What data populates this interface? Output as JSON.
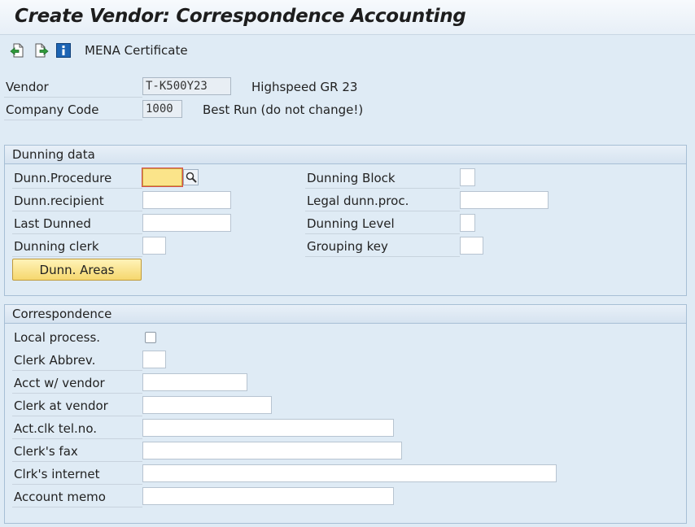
{
  "window": {
    "title": "Create Vendor: Correspondence Accounting"
  },
  "toolbar": {
    "icons": [
      "prev-screen-icon",
      "next-screen-icon",
      "info-icon"
    ],
    "mena_label": "MENA Certificate"
  },
  "header": {
    "vendor_label": "Vendor",
    "vendor_value": "T-K500Y23",
    "vendor_name": "Highspeed GR 23",
    "company_label": "Company Code",
    "company_value": "1000",
    "company_name": "Best Run (do not change!)"
  },
  "dunning": {
    "title": "Dunning data",
    "procedure_label": "Dunn.Procedure",
    "procedure_value": "",
    "recipient_label": "Dunn.recipient",
    "recipient_value": "",
    "last_dunned_label": "Last Dunned",
    "last_dunned_value": "",
    "clerk_label": "Dunning clerk",
    "clerk_value": "",
    "block_label": "Dunning Block",
    "block_value": "",
    "legal_label": "Legal dunn.proc.",
    "legal_value": "",
    "level_label": "Dunning Level",
    "level_value": "",
    "grouping_label": "Grouping key",
    "grouping_value": "",
    "areas_button": "Dunn. Areas"
  },
  "correspondence": {
    "title": "Correspondence",
    "local_process_label": "Local process.",
    "local_process_checked": false,
    "clerk_abbrev_label": "Clerk Abbrev.",
    "clerk_abbrev_value": "",
    "acct_vendor_label": "Acct w/ vendor",
    "acct_vendor_value": "",
    "clerk_vendor_label": "Clerk at vendor",
    "clerk_vendor_value": "",
    "tel_label": "Act.clk tel.no.",
    "tel_value": "",
    "fax_label": "Clerk's fax",
    "fax_value": "",
    "internet_label": "Clrk's internet",
    "internet_value": "",
    "memo_label": "Account memo",
    "memo_value": ""
  },
  "colors": {
    "background": "#dfebf5",
    "focus_field": "#fbe48a",
    "button": "#f5d76e"
  }
}
